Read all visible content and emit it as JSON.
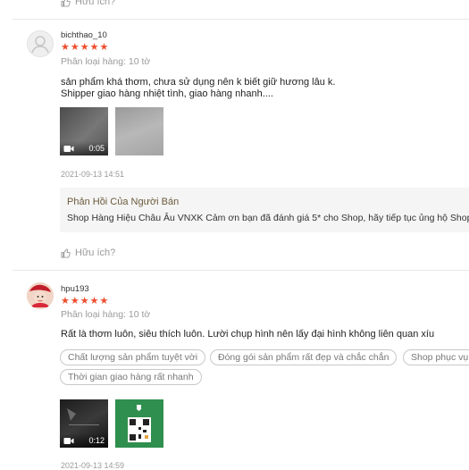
{
  "colors": {
    "star": "#ee4d2d",
    "muted": "#9a9a9a",
    "reply_title": "#6b5a3a",
    "reply_bg": "#f5f5f5"
  },
  "top": {
    "helpful_label": "Hữu ích?"
  },
  "review1": {
    "username": "bichthao_10",
    "stars": "★★★★★",
    "variation": "Phân loại hàng: 10 tờ",
    "comment_line1": "sản phẩm khá thơm, chưa sử dụng nên k biết giữ hương lâu k.",
    "comment_line2": "Shipper giao hàng nhiệt tình, giao hàng nhanh....",
    "video_duration": "0:05",
    "timestamp": "2021-09-13 14:51",
    "reply_title": "Phản Hồi Của Người Bán",
    "reply_text": "Shop Hàng Hiệu Châu Âu VNXK Cảm ơn bạn đã đánh giá 5* cho Shop, hãy tiếp tục ủng hộ Shop",
    "helpful_label": "Hữu ích?"
  },
  "review2": {
    "username": "hpu193",
    "stars": "★★★★★",
    "variation": "Phân loại hàng: 10 tờ",
    "comment": "Rất là thơm luôn, siêu thích luôn. Lười chụp hình nên lấy đại hình không liên quan xíu",
    "tags": [
      "Chất lượng sản phẩm tuyệt vời",
      "Đóng gói sản phẩm rất đẹp và chắc chắn",
      "Shop phục vụ",
      "Thời gian giao hàng rất nhanh"
    ],
    "video_duration": "0:12",
    "timestamp": "2021-09-13 14:59"
  }
}
